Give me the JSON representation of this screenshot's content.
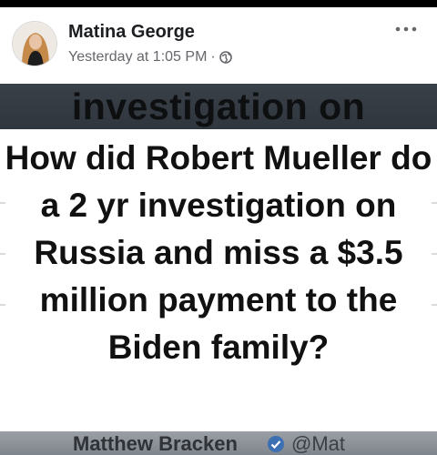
{
  "post": {
    "author": "Matina George",
    "timestamp": "Yesterday at 1:05 PM",
    "separator": "·",
    "privacy_icon": "globe-icon",
    "more_icon": "more-options-icon"
  },
  "image": {
    "top_strip_text": "investigation on",
    "headline": "How did Robert Mueller do a 2 yr investigation on Russia and miss a $3.5 million payment to the Biden family?",
    "bottom_strip_name": "Matthew Bracken",
    "bottom_strip_handle": "@Mat"
  },
  "colors": {
    "header_background": "#ffffff",
    "name_text": "#1c1e21",
    "meta_text": "#65676b",
    "image_dark_bg": "#2b323c",
    "headline_text": "#111111"
  }
}
